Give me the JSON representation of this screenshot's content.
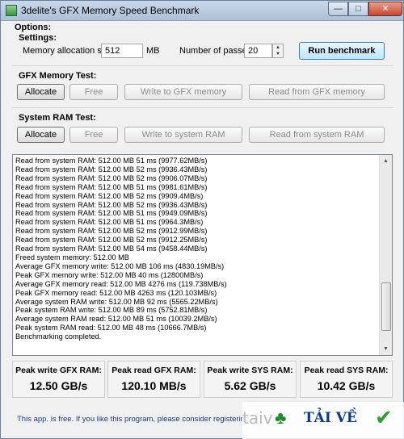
{
  "window": {
    "title": "3delite's GFX Memory Speed Benchmark"
  },
  "options": {
    "title": "Options:",
    "settings_title": "Settings:",
    "mem_alloc_label": "Memory allocation size:",
    "mem_alloc_value": "512",
    "mem_unit": "MB",
    "passes_label": "Number of passes:",
    "passes_value": "20",
    "run_button": "Run benchmark"
  },
  "gfx_test": {
    "title": "GFX Memory Test:",
    "allocate": "Allocate",
    "free": "Free",
    "write": "Write to GFX memory",
    "read": "Read from GFX memory"
  },
  "sys_test": {
    "title": "System RAM Test:",
    "allocate": "Allocate",
    "free": "Free",
    "write": "Write to system RAM",
    "read": "Read from system RAM"
  },
  "log": [
    "Read from system RAM: 512.00 MB 51 ms (9977.62MB/s)",
    "Read from system RAM: 512.00 MB 52 ms (9936.43MB/s)",
    "Read from system RAM: 512.00 MB 52 ms (9906.07MB/s)",
    "Read from system RAM: 512.00 MB 51 ms (9981.61MB/s)",
    "Read from system RAM: 512.00 MB 52 ms (9909.4MB/s)",
    "Read from system RAM: 512.00 MB 52 ms (9936.43MB/s)",
    "Read from system RAM: 512.00 MB 51 ms (9949.09MB/s)",
    "Read from system RAM: 512.00 MB 51 ms (9964.3MB/s)",
    "Read from system RAM: 512.00 MB 52 ms (9912.99MB/s)",
    "Read from system RAM: 512.00 MB 52 ms (9912.25MB/s)",
    "Read from system RAM: 512.00 MB 54 ms (9458.44MB/s)",
    "Freed system memory: 512.00 MB",
    "Average GFX memory write: 512.00 MB 106 ms (4830.19MB/s)",
    "Peak GFX memory write: 512.00 MB 40 ms (12800MB/s)",
    "Average GFX memory read: 512.00 MB 4276 ms (119.738MB/s)",
    "Peak GFX memory read: 512.00 MB 4263 ms (120.103MB/s)",
    "Average system RAM write: 512.00 MB 92 ms (5565.22MB/s)",
    "Peak system RAM write: 512.00 MB 89 ms (5752.81MB/s)",
    "Average system RAM read: 512.00 MB 51 ms (10039.2MB/s)",
    "Peak system RAM read: 512.00 MB 48 ms (10666.7MB/s)",
    "Benchmarking completed."
  ],
  "stats": [
    {
      "label": "Peak write GFX RAM:",
      "value": "12.50 GB/s"
    },
    {
      "label": "Peak read GFX RAM:",
      "value": "120.10 MB/s"
    },
    {
      "label": "Peak write SYS RAM:",
      "value": "5.62 GB/s"
    },
    {
      "label": "Peak read SYS RAM:",
      "value": "10.42 GB/s"
    }
  ],
  "footer": "This app. is free. If you like this program, please consider registering",
  "watermark": {
    "prefix": "taiv",
    "brand": "TẢI VỀ"
  }
}
